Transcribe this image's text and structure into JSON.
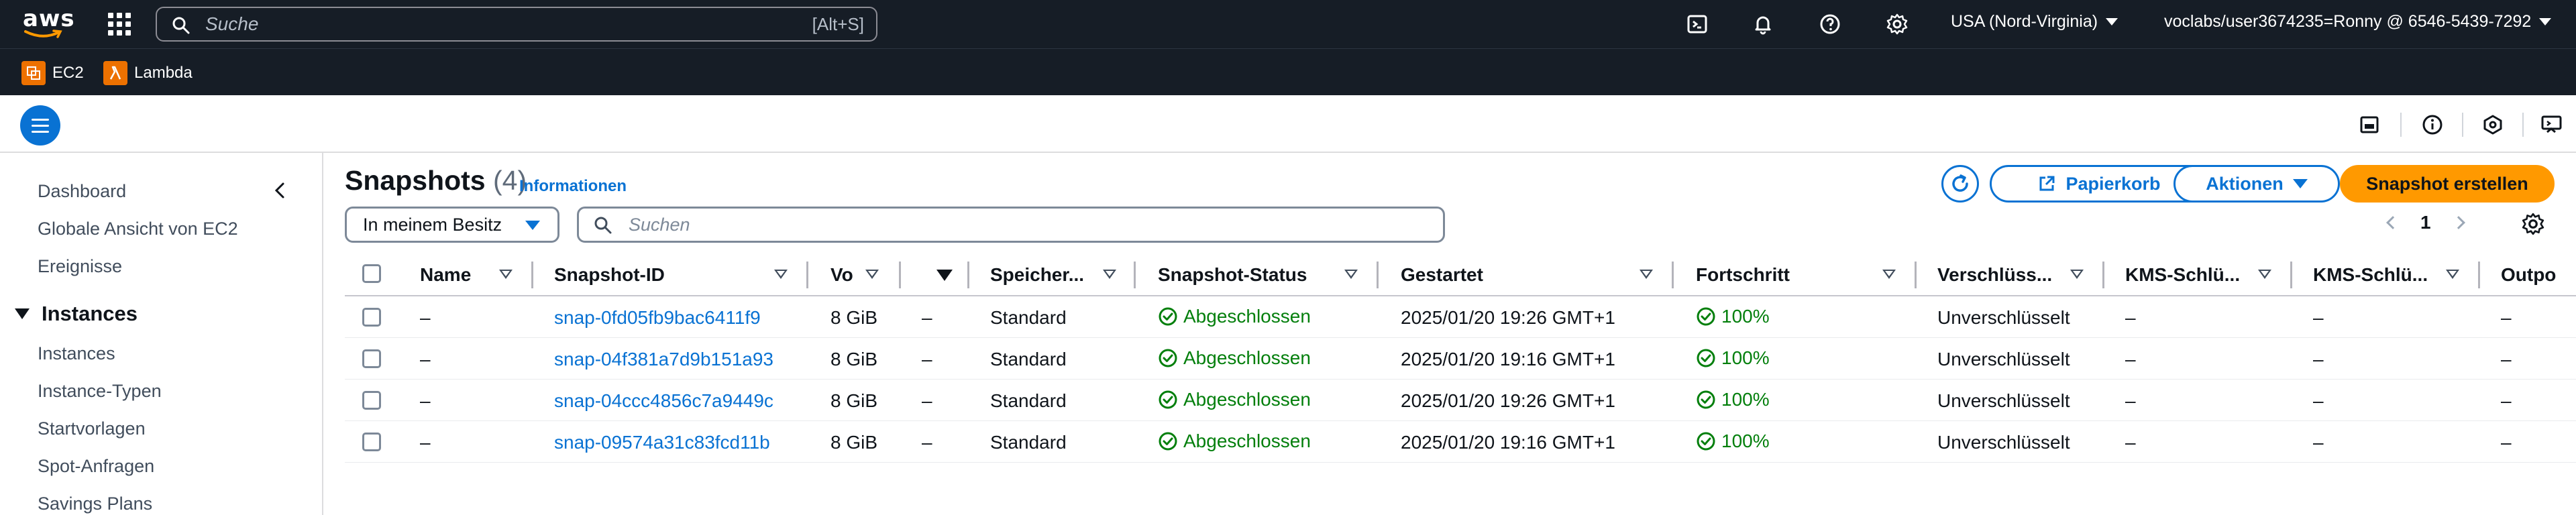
{
  "topnav": {
    "logo_text": "aws",
    "search_placeholder": "Suche",
    "search_shortcut": "[Alt+S]",
    "icons": [
      "cloudshell-icon",
      "bell-icon",
      "help-icon",
      "gear-icon"
    ],
    "region": "USA (Nord-Virginia)",
    "account": "voclabs/user3674235=Ronny @ 6546-5439-7292"
  },
  "favorites": [
    {
      "label": "EC2",
      "color": "#ed7100",
      "icon": "ec2-icon"
    },
    {
      "label": "Lambda",
      "color": "#ed7100",
      "icon": "lambda-icon"
    }
  ],
  "subbar": {
    "icons": [
      "panel-icon",
      "info-icon",
      "notification-icon",
      "feedback-icon"
    ]
  },
  "sidebar": {
    "items_top": [
      "Dashboard",
      "Globale Ansicht von EC2",
      "Ereignisse"
    ],
    "section": "Instances",
    "section_items": [
      "Instances",
      "Instance-Typen",
      "Startvorlagen",
      "Spot-Anfragen",
      "Savings Plans"
    ]
  },
  "main": {
    "title": "Snapshots",
    "count": "(4)",
    "info_link": "Informationen",
    "buttons": {
      "recycle": "Papierkorb",
      "actions": "Aktionen",
      "create": "Snapshot erstellen"
    },
    "filter": "In meinem Besitz",
    "search_placeholder": "Suchen",
    "page": "1"
  },
  "table": {
    "columns": [
      "Name",
      "Snapshot-ID",
      "Vo",
      "",
      "Speicher...",
      "Snapshot-Status",
      "Gestartet",
      "Fortschritt",
      "Verschlüss...",
      "KMS-Schlü...",
      "KMS-Schlü...",
      "Outpo"
    ],
    "rows": [
      {
        "name": "–",
        "id": "snap-0fd05fb9bac6411f9",
        "size": "8 GiB",
        "blank": "–",
        "storage": "Standard",
        "status": "Abgeschlossen",
        "started": "2025/01/20 19:26 GMT+1",
        "progress": "100%",
        "encryption": "Unverschlüsselt",
        "kms1": "–",
        "kms2": "–",
        "outpost": "–"
      },
      {
        "name": "–",
        "id": "snap-04f381a7d9b151a93",
        "size": "8 GiB",
        "blank": "–",
        "storage": "Standard",
        "status": "Abgeschlossen",
        "started": "2025/01/20 19:16 GMT+1",
        "progress": "100%",
        "encryption": "Unverschlüsselt",
        "kms1": "–",
        "kms2": "–",
        "outpost": "–"
      },
      {
        "name": "–",
        "id": "snap-04ccc4856c7a9449c",
        "size": "8 GiB",
        "blank": "–",
        "storage": "Standard",
        "status": "Abgeschlossen",
        "started": "2025/01/20 19:26 GMT+1",
        "progress": "100%",
        "encryption": "Unverschlüsselt",
        "kms1": "–",
        "kms2": "–",
        "outpost": "–"
      },
      {
        "name": "–",
        "id": "snap-09574a31c83fcd11b",
        "size": "8 GiB",
        "blank": "–",
        "storage": "Standard",
        "status": "Abgeschlossen",
        "started": "2025/01/20 19:16 GMT+1",
        "progress": "100%",
        "encryption": "Unverschlüsselt",
        "kms1": "–",
        "kms2": "–",
        "outpost": "–"
      }
    ]
  },
  "colors": {
    "nav_bg": "#161d26",
    "link": "#0972d3",
    "primary": "#ff9900",
    "success": "#037f0c"
  }
}
